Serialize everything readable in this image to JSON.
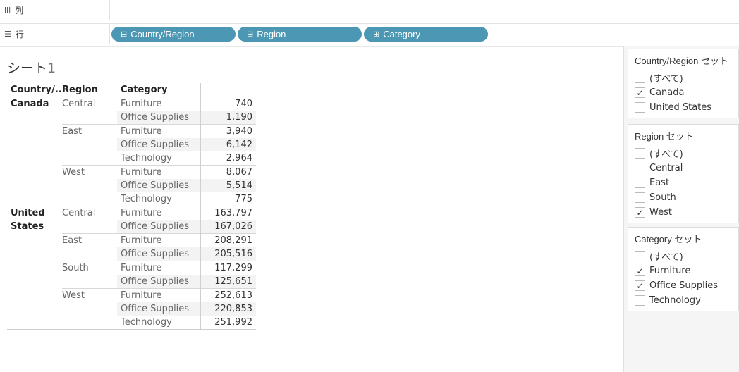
{
  "shelves": {
    "columns_label": "列",
    "columns_icon": "columns-icon",
    "rows_label": "行",
    "rows_icon": "rows-icon",
    "row_pills": [
      {
        "label": "Country/Region",
        "state": "⊟"
      },
      {
        "label": "Region",
        "state": "⊞"
      },
      {
        "label": "Category",
        "state": "⊞"
      }
    ]
  },
  "sheet": {
    "title": "シート",
    "title_number": "1"
  },
  "table": {
    "headers": {
      "country": "Country/..",
      "region": "Region",
      "category": "Category",
      "value": ""
    },
    "rows": [
      {
        "country": "Canada",
        "region": "Central",
        "category": "Furniture",
        "value": "740"
      },
      {
        "country": "",
        "region": "",
        "category": "Office Supplies",
        "value": "1,190"
      },
      {
        "country": "",
        "region": "East",
        "category": "Furniture",
        "value": "3,940"
      },
      {
        "country": "",
        "region": "",
        "category": "Office Supplies",
        "value": "6,142"
      },
      {
        "country": "",
        "region": "",
        "category": "Technology",
        "value": "2,964"
      },
      {
        "country": "",
        "region": "West",
        "category": "Furniture",
        "value": "8,067"
      },
      {
        "country": "",
        "region": "",
        "category": "Office Supplies",
        "value": "5,514"
      },
      {
        "country": "",
        "region": "",
        "category": "Technology",
        "value": "775"
      },
      {
        "country": "United",
        "region": "Central",
        "category": "Furniture",
        "value": "163,797"
      },
      {
        "country": "States",
        "region": "",
        "category": "Office Supplies",
        "value": "167,026"
      },
      {
        "country": "",
        "region": "East",
        "category": "Furniture",
        "value": "208,291"
      },
      {
        "country": "",
        "region": "",
        "category": "Office Supplies",
        "value": "205,516"
      },
      {
        "country": "",
        "region": "South",
        "category": "Furniture",
        "value": "117,299"
      },
      {
        "country": "",
        "region": "",
        "category": "Office Supplies",
        "value": "125,651"
      },
      {
        "country": "",
        "region": "West",
        "category": "Furniture",
        "value": "252,613"
      },
      {
        "country": "",
        "region": "",
        "category": "Office Supplies",
        "value": "220,853"
      },
      {
        "country": "",
        "region": "",
        "category": "Technology",
        "value": "251,992"
      }
    ]
  },
  "filters": {
    "country": {
      "title": "Country/Region セット",
      "options": [
        {
          "label": "(すべて)",
          "checked": false
        },
        {
          "label": "Canada",
          "checked": true
        },
        {
          "label": "United States",
          "checked": false
        }
      ]
    },
    "region": {
      "title": "Region セット",
      "options": [
        {
          "label": "(すべて)",
          "checked": false
        },
        {
          "label": "Central",
          "checked": false
        },
        {
          "label": "East",
          "checked": false
        },
        {
          "label": "South",
          "checked": false
        },
        {
          "label": "West",
          "checked": true
        }
      ]
    },
    "category": {
      "title": "Category セット",
      "options": [
        {
          "label": "(すべて)",
          "checked": false
        },
        {
          "label": "Furniture",
          "checked": true
        },
        {
          "label": "Office Supplies",
          "checked": true
        },
        {
          "label": "Technology",
          "checked": false
        }
      ]
    }
  }
}
